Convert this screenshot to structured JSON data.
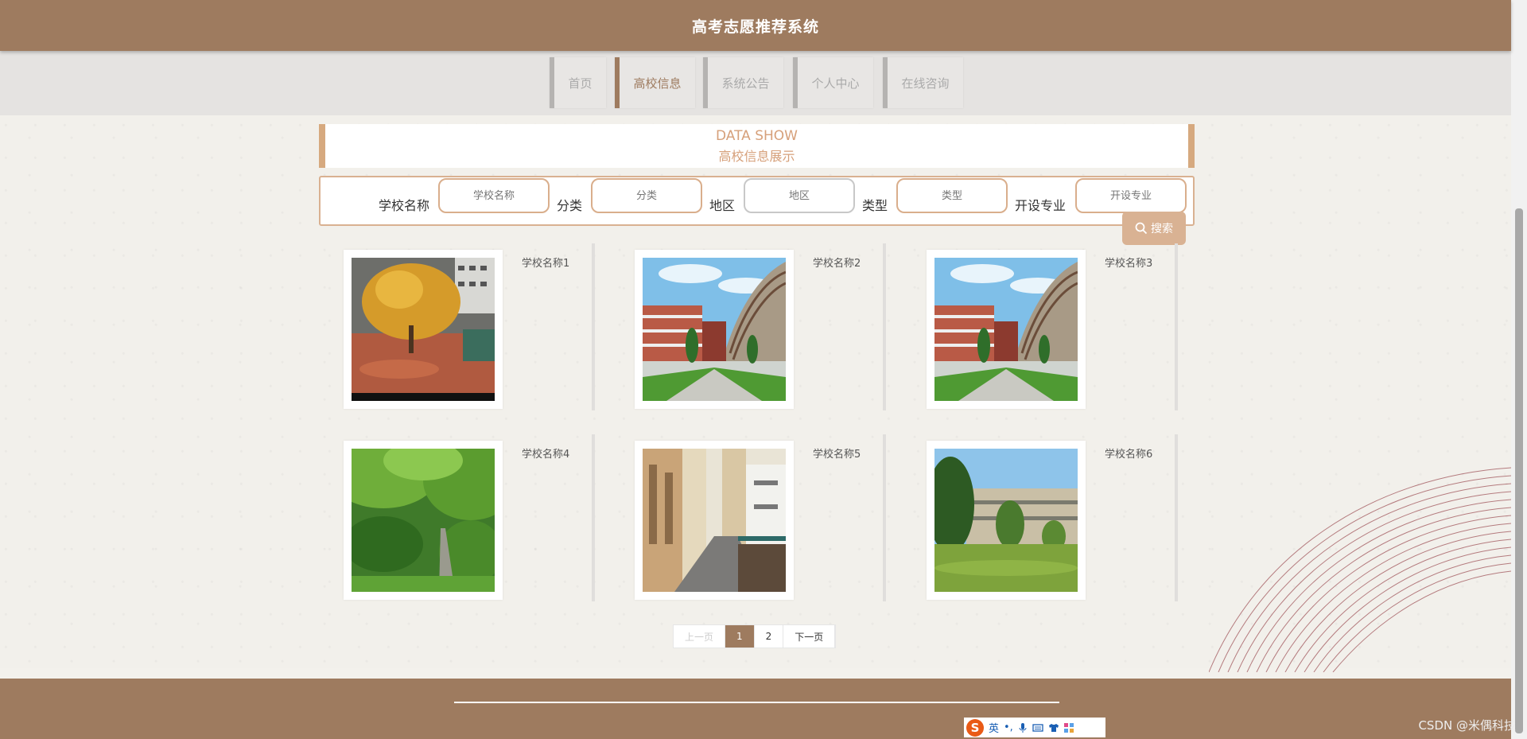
{
  "header": {
    "title": "高考志愿推荐系统"
  },
  "nav": {
    "items": [
      {
        "label": "首页"
      },
      {
        "label": "高校信息"
      },
      {
        "label": "系统公告"
      },
      {
        "label": "个人中心"
      },
      {
        "label": "在线咨询"
      }
    ],
    "active": "高校信息"
  },
  "section": {
    "title_en": "DATA SHOW",
    "title_cn": "高校信息展示"
  },
  "search": {
    "fields": [
      {
        "label": "学校名称",
        "placeholder": "学校名称"
      },
      {
        "label": "分类",
        "placeholder": "分类"
      },
      {
        "label": "地区",
        "placeholder": "地区"
      },
      {
        "label": "类型",
        "placeholder": "类型"
      },
      {
        "label": "开设专业",
        "placeholder": "开设专业"
      }
    ],
    "button_label": "搜索"
  },
  "schools": [
    {
      "name": "学校名称1",
      "image": "autumn-tree-campus"
    },
    {
      "name": "学校名称2",
      "image": "campus-courtyard"
    },
    {
      "name": "学校名称3",
      "image": "campus-courtyard"
    },
    {
      "name": "学校名称4",
      "image": "garden-path"
    },
    {
      "name": "学校名称5",
      "image": "corridor"
    },
    {
      "name": "学校名称6",
      "image": "campus-building-lawn"
    }
  ],
  "pagination": {
    "prev": "上一页",
    "pages": [
      "1",
      "2"
    ],
    "current": "1",
    "next": "下一页"
  },
  "ime": {
    "mode": "英",
    "punct": "•,"
  },
  "watermark": "CSDN @米偶科技",
  "colors": {
    "brand": "#9e7b5f",
    "accent": "#d6a97f",
    "nav_bg": "#e5e3e1"
  }
}
